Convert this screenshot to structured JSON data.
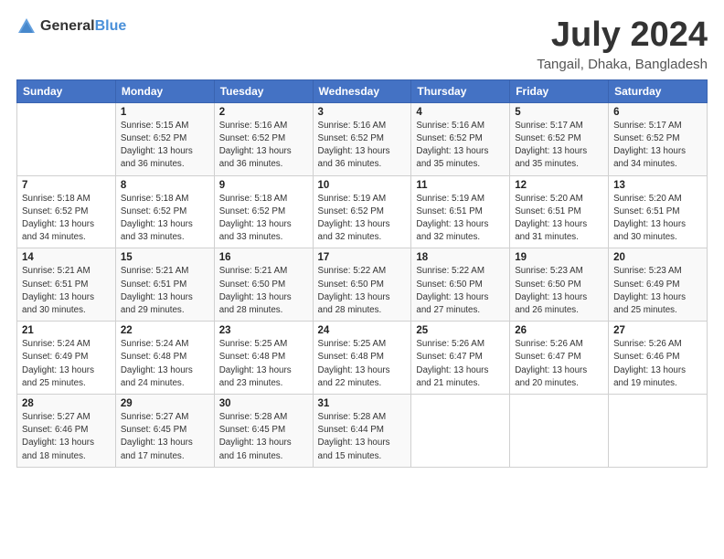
{
  "logo": {
    "text_general": "General",
    "text_blue": "Blue"
  },
  "title": {
    "main": "July 2024",
    "sub": "Tangail, Dhaka, Bangladesh"
  },
  "days_of_week": [
    "Sunday",
    "Monday",
    "Tuesday",
    "Wednesday",
    "Thursday",
    "Friday",
    "Saturday"
  ],
  "weeks": [
    [
      {
        "day": "",
        "sunrise": "",
        "sunset": "",
        "daylight": ""
      },
      {
        "day": "1",
        "sunrise": "Sunrise: 5:15 AM",
        "sunset": "Sunset: 6:52 PM",
        "daylight": "Daylight: 13 hours and 36 minutes."
      },
      {
        "day": "2",
        "sunrise": "Sunrise: 5:16 AM",
        "sunset": "Sunset: 6:52 PM",
        "daylight": "Daylight: 13 hours and 36 minutes."
      },
      {
        "day": "3",
        "sunrise": "Sunrise: 5:16 AM",
        "sunset": "Sunset: 6:52 PM",
        "daylight": "Daylight: 13 hours and 36 minutes."
      },
      {
        "day": "4",
        "sunrise": "Sunrise: 5:16 AM",
        "sunset": "Sunset: 6:52 PM",
        "daylight": "Daylight: 13 hours and 35 minutes."
      },
      {
        "day": "5",
        "sunrise": "Sunrise: 5:17 AM",
        "sunset": "Sunset: 6:52 PM",
        "daylight": "Daylight: 13 hours and 35 minutes."
      },
      {
        "day": "6",
        "sunrise": "Sunrise: 5:17 AM",
        "sunset": "Sunset: 6:52 PM",
        "daylight": "Daylight: 13 hours and 34 minutes."
      }
    ],
    [
      {
        "day": "7",
        "sunrise": "Sunrise: 5:18 AM",
        "sunset": "Sunset: 6:52 PM",
        "daylight": "Daylight: 13 hours and 34 minutes."
      },
      {
        "day": "8",
        "sunrise": "Sunrise: 5:18 AM",
        "sunset": "Sunset: 6:52 PM",
        "daylight": "Daylight: 13 hours and 33 minutes."
      },
      {
        "day": "9",
        "sunrise": "Sunrise: 5:18 AM",
        "sunset": "Sunset: 6:52 PM",
        "daylight": "Daylight: 13 hours and 33 minutes."
      },
      {
        "day": "10",
        "sunrise": "Sunrise: 5:19 AM",
        "sunset": "Sunset: 6:52 PM",
        "daylight": "Daylight: 13 hours and 32 minutes."
      },
      {
        "day": "11",
        "sunrise": "Sunrise: 5:19 AM",
        "sunset": "Sunset: 6:51 PM",
        "daylight": "Daylight: 13 hours and 32 minutes."
      },
      {
        "day": "12",
        "sunrise": "Sunrise: 5:20 AM",
        "sunset": "Sunset: 6:51 PM",
        "daylight": "Daylight: 13 hours and 31 minutes."
      },
      {
        "day": "13",
        "sunrise": "Sunrise: 5:20 AM",
        "sunset": "Sunset: 6:51 PM",
        "daylight": "Daylight: 13 hours and 30 minutes."
      }
    ],
    [
      {
        "day": "14",
        "sunrise": "Sunrise: 5:21 AM",
        "sunset": "Sunset: 6:51 PM",
        "daylight": "Daylight: 13 hours and 30 minutes."
      },
      {
        "day": "15",
        "sunrise": "Sunrise: 5:21 AM",
        "sunset": "Sunset: 6:51 PM",
        "daylight": "Daylight: 13 hours and 29 minutes."
      },
      {
        "day": "16",
        "sunrise": "Sunrise: 5:21 AM",
        "sunset": "Sunset: 6:50 PM",
        "daylight": "Daylight: 13 hours and 28 minutes."
      },
      {
        "day": "17",
        "sunrise": "Sunrise: 5:22 AM",
        "sunset": "Sunset: 6:50 PM",
        "daylight": "Daylight: 13 hours and 28 minutes."
      },
      {
        "day": "18",
        "sunrise": "Sunrise: 5:22 AM",
        "sunset": "Sunset: 6:50 PM",
        "daylight": "Daylight: 13 hours and 27 minutes."
      },
      {
        "day": "19",
        "sunrise": "Sunrise: 5:23 AM",
        "sunset": "Sunset: 6:50 PM",
        "daylight": "Daylight: 13 hours and 26 minutes."
      },
      {
        "day": "20",
        "sunrise": "Sunrise: 5:23 AM",
        "sunset": "Sunset: 6:49 PM",
        "daylight": "Daylight: 13 hours and 25 minutes."
      }
    ],
    [
      {
        "day": "21",
        "sunrise": "Sunrise: 5:24 AM",
        "sunset": "Sunset: 6:49 PM",
        "daylight": "Daylight: 13 hours and 25 minutes."
      },
      {
        "day": "22",
        "sunrise": "Sunrise: 5:24 AM",
        "sunset": "Sunset: 6:48 PM",
        "daylight": "Daylight: 13 hours and 24 minutes."
      },
      {
        "day": "23",
        "sunrise": "Sunrise: 5:25 AM",
        "sunset": "Sunset: 6:48 PM",
        "daylight": "Daylight: 13 hours and 23 minutes."
      },
      {
        "day": "24",
        "sunrise": "Sunrise: 5:25 AM",
        "sunset": "Sunset: 6:48 PM",
        "daylight": "Daylight: 13 hours and 22 minutes."
      },
      {
        "day": "25",
        "sunrise": "Sunrise: 5:26 AM",
        "sunset": "Sunset: 6:47 PM",
        "daylight": "Daylight: 13 hours and 21 minutes."
      },
      {
        "day": "26",
        "sunrise": "Sunrise: 5:26 AM",
        "sunset": "Sunset: 6:47 PM",
        "daylight": "Daylight: 13 hours and 20 minutes."
      },
      {
        "day": "27",
        "sunrise": "Sunrise: 5:26 AM",
        "sunset": "Sunset: 6:46 PM",
        "daylight": "Daylight: 13 hours and 19 minutes."
      }
    ],
    [
      {
        "day": "28",
        "sunrise": "Sunrise: 5:27 AM",
        "sunset": "Sunset: 6:46 PM",
        "daylight": "Daylight: 13 hours and 18 minutes."
      },
      {
        "day": "29",
        "sunrise": "Sunrise: 5:27 AM",
        "sunset": "Sunset: 6:45 PM",
        "daylight": "Daylight: 13 hours and 17 minutes."
      },
      {
        "day": "30",
        "sunrise": "Sunrise: 5:28 AM",
        "sunset": "Sunset: 6:45 PM",
        "daylight": "Daylight: 13 hours and 16 minutes."
      },
      {
        "day": "31",
        "sunrise": "Sunrise: 5:28 AM",
        "sunset": "Sunset: 6:44 PM",
        "daylight": "Daylight: 13 hours and 15 minutes."
      },
      {
        "day": "",
        "sunrise": "",
        "sunset": "",
        "daylight": ""
      },
      {
        "day": "",
        "sunrise": "",
        "sunset": "",
        "daylight": ""
      },
      {
        "day": "",
        "sunrise": "",
        "sunset": "",
        "daylight": ""
      }
    ]
  ]
}
